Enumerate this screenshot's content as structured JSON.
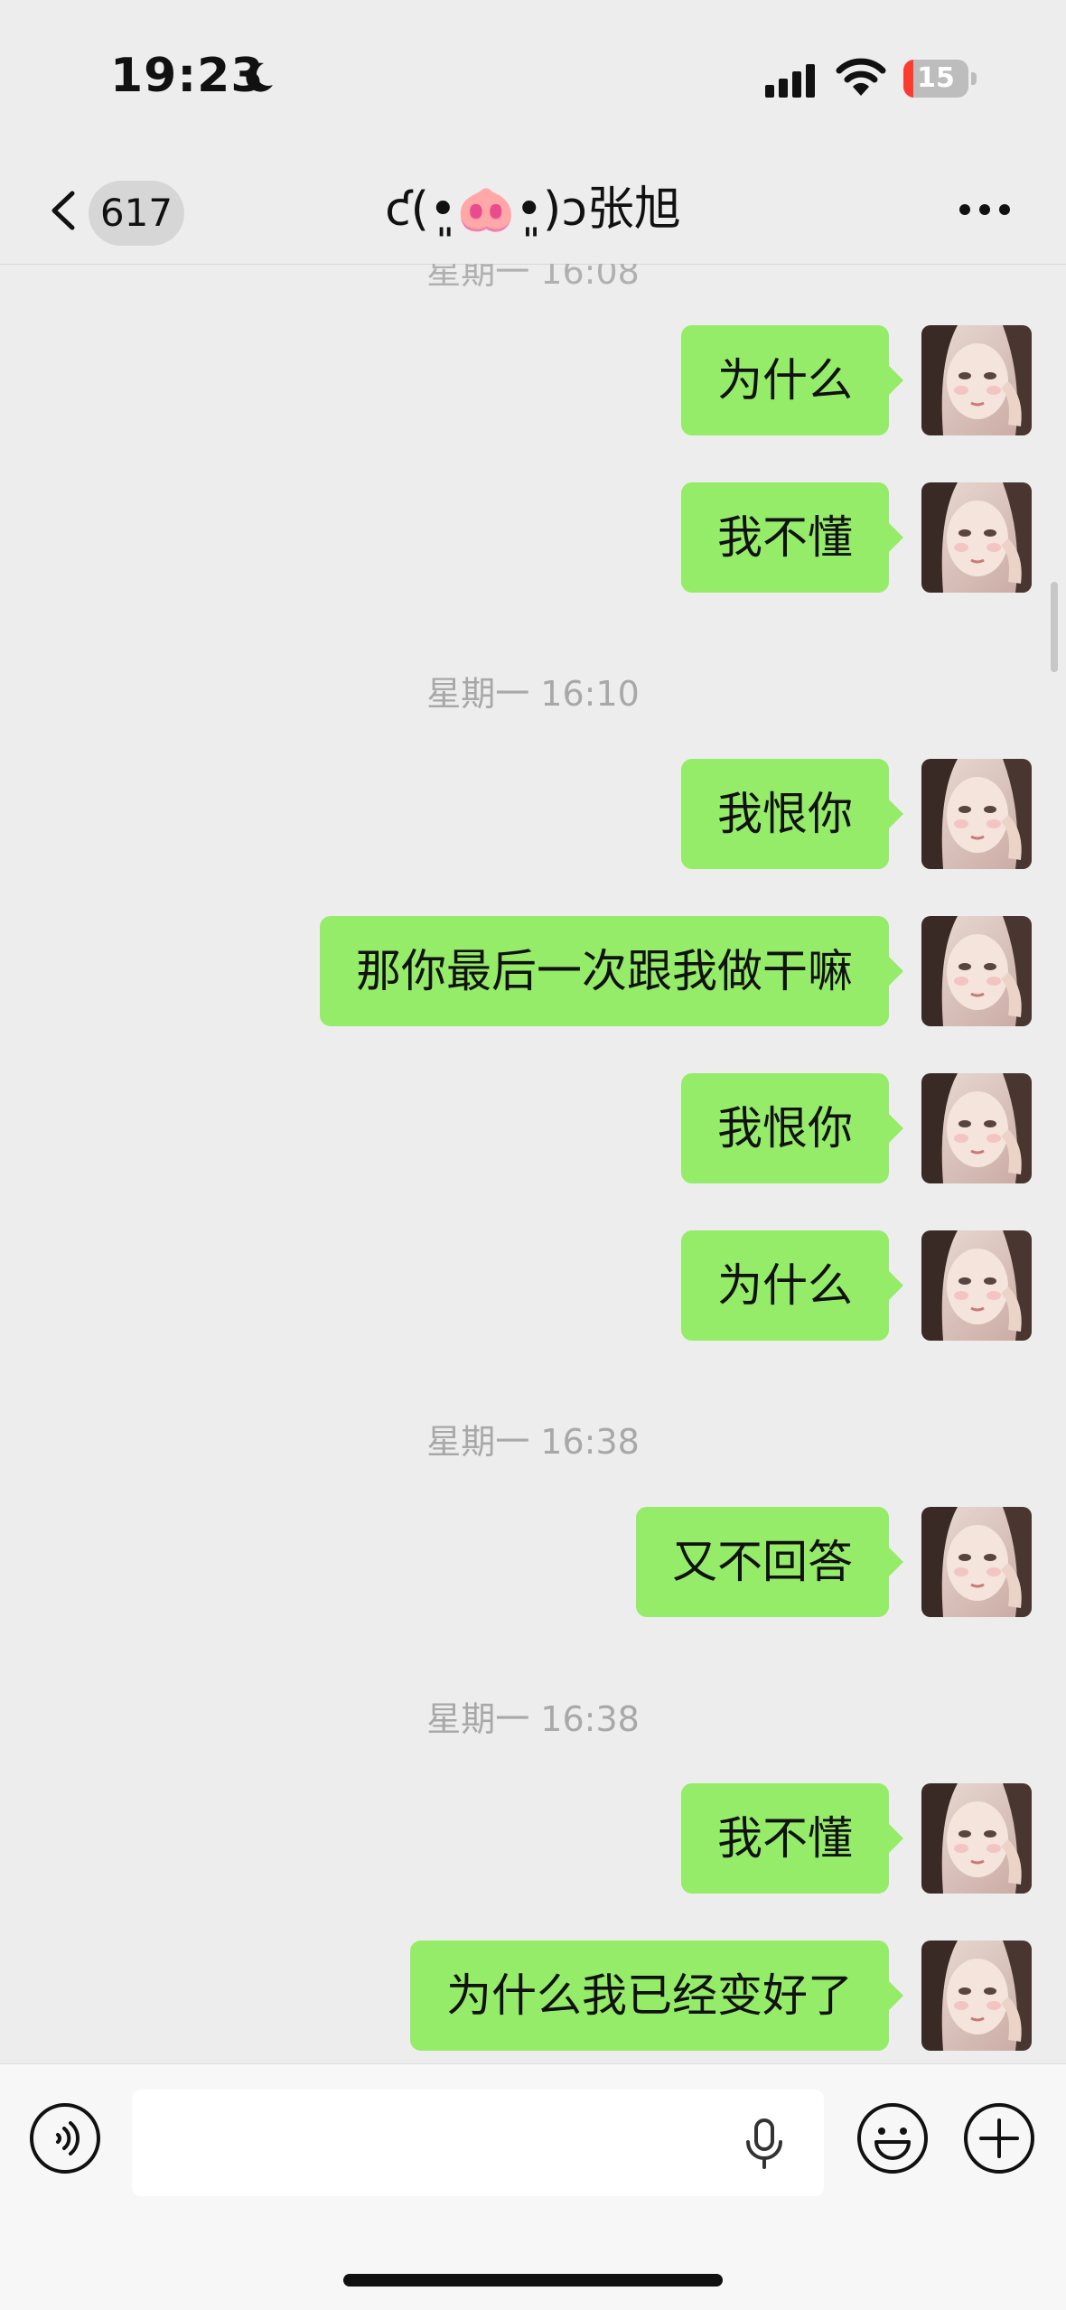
{
  "status_bar": {
    "time": "19:23",
    "battery_level": "15",
    "moon_icon": "moon-icon",
    "signal_icon": "cellular-signal-icon",
    "wifi_icon": "wifi-icon",
    "battery_icon": "battery-charging-icon",
    "battery_fraction": 0.15,
    "battery_color": "#ff3b30"
  },
  "nav": {
    "back_icon": "chevron-left-icon",
    "unread_count": "617",
    "title": "ƈ(•͈🐽•͈)ɔ张旭",
    "more_icon": "more-dots-icon"
  },
  "chat": {
    "partial_timestamp": "星期一 16:08",
    "bubble_color": "#95ec69",
    "background": "#ededed",
    "timestamps": [
      "星期一 16:10",
      "星期一 16:38",
      "星期一 16:38"
    ],
    "messages": [
      {
        "text": "为什么",
        "sender": "self"
      },
      {
        "text": "我不懂",
        "sender": "self"
      },
      {
        "text": "我恨你",
        "sender": "self"
      },
      {
        "text": "那你最后一次跟我做干嘛",
        "sender": "self"
      },
      {
        "text": "我恨你",
        "sender": "self"
      },
      {
        "text": "为什么",
        "sender": "self"
      },
      {
        "text": "又不回答",
        "sender": "self"
      },
      {
        "text": "我不懂",
        "sender": "self"
      },
      {
        "text": "为什么我已经变好了",
        "sender": "self"
      }
    ]
  },
  "input_bar": {
    "voice_icon": "voice-mode-icon",
    "mic_icon": "microphone-icon",
    "emoji_icon": "emoji-icon",
    "plus_icon": "plus-icon",
    "input_value": ""
  }
}
